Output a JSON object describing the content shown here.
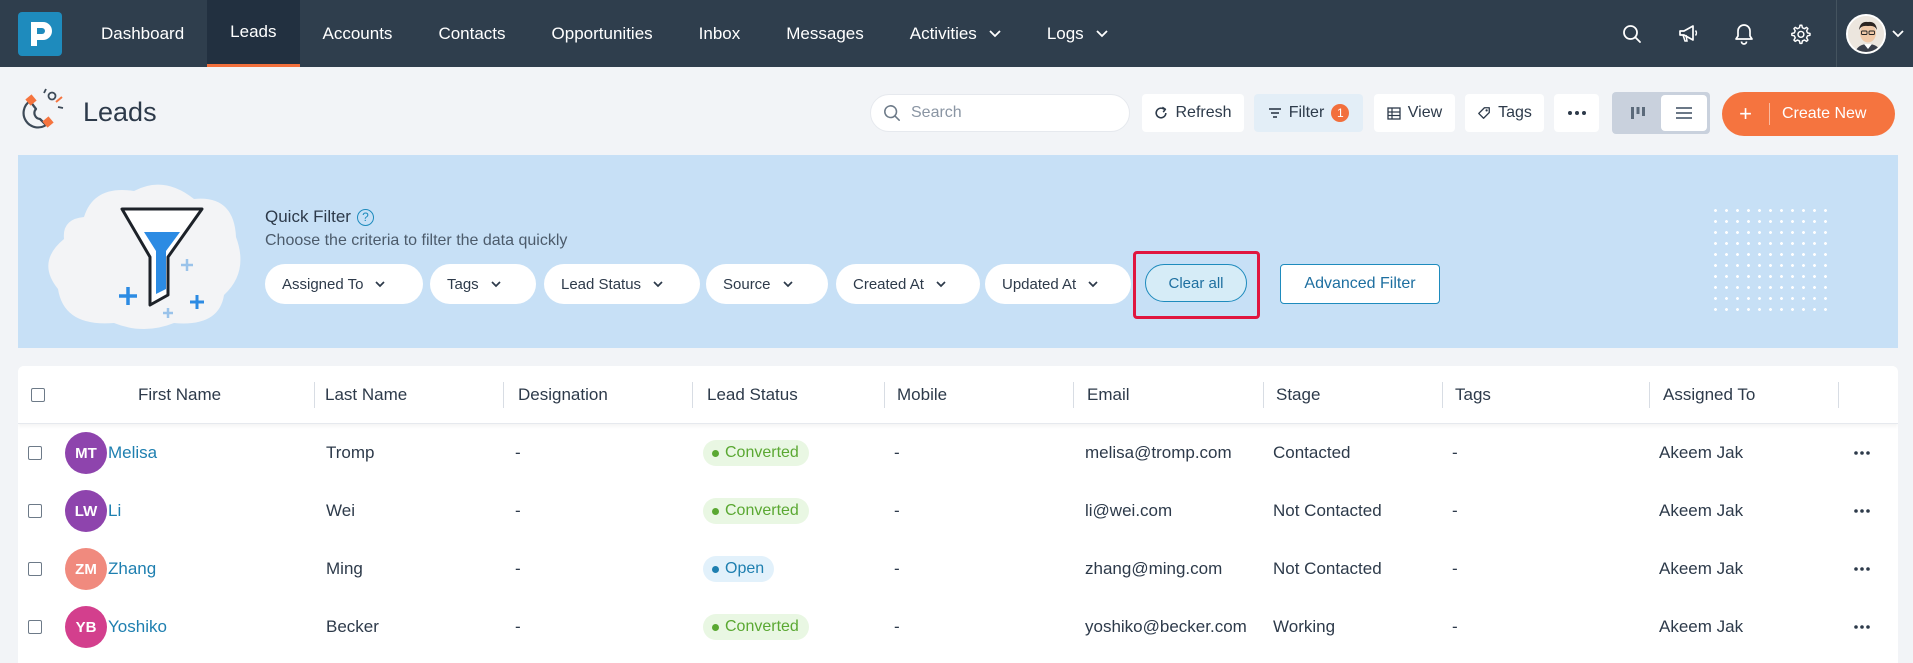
{
  "nav": {
    "items": [
      {
        "label": "Dashboard",
        "active": false,
        "dropdown": false
      },
      {
        "label": "Leads",
        "active": true,
        "dropdown": false
      },
      {
        "label": "Accounts",
        "active": false,
        "dropdown": false
      },
      {
        "label": "Contacts",
        "active": false,
        "dropdown": false
      },
      {
        "label": "Opportunities",
        "active": false,
        "dropdown": false
      },
      {
        "label": "Inbox",
        "active": false,
        "dropdown": false
      },
      {
        "label": "Messages",
        "active": false,
        "dropdown": false
      },
      {
        "label": "Activities",
        "active": false,
        "dropdown": true
      },
      {
        "label": "Logs",
        "active": false,
        "dropdown": true
      }
    ],
    "icons": [
      "search-icon",
      "megaphone-icon",
      "bell-icon",
      "gear-icon"
    ]
  },
  "header": {
    "title": "Leads",
    "search_placeholder": "Search",
    "refresh_label": "Refresh",
    "filter_label": "Filter",
    "filter_count": "1",
    "view_label": "View",
    "tags_label": "Tags",
    "create_label": "Create New",
    "create_plus": "+"
  },
  "quick_filter": {
    "title": "Quick Filter",
    "help": "?",
    "subtitle": "Choose the criteria to filter the data quickly",
    "chips": [
      "Assigned To",
      "Tags",
      "Lead Status",
      "Source",
      "Created At",
      "Updated At"
    ],
    "clear_label": "Clear all",
    "advanced_label": "Advanced Filter"
  },
  "table": {
    "columns": [
      "First Name",
      "Last Name",
      "Designation",
      "Lead Status",
      "Mobile",
      "Email",
      "Stage",
      "Tags",
      "Assigned To"
    ],
    "rows": [
      {
        "initials": "MT",
        "avatar_color": "#8e44ad",
        "first": "Melisa",
        "last": "Tromp",
        "designation": "-",
        "status": "Converted",
        "mobile": "-",
        "email": "melisa@tromp.com",
        "stage": "Contacted",
        "tags": "-",
        "assigned": "Akeem Jak"
      },
      {
        "initials": "LW",
        "avatar_color": "#8e44ad",
        "first": "Li",
        "last": "Wei",
        "designation": "-",
        "status": "Converted",
        "mobile": "-",
        "email": "li@wei.com",
        "stage": "Not Contacted",
        "tags": "-",
        "assigned": "Akeem Jak"
      },
      {
        "initials": "ZM",
        "avatar_color": "#f08a7e",
        "first": "Zhang",
        "last": "Ming",
        "designation": "-",
        "status": "Open",
        "mobile": "-",
        "email": "zhang@ming.com",
        "stage": "Not Contacted",
        "tags": "-",
        "assigned": "Akeem Jak"
      },
      {
        "initials": "YB",
        "avatar_color": "#d33f8d",
        "first": "Yoshiko",
        "last": "Becker",
        "designation": "-",
        "status": "Converted",
        "mobile": "-",
        "email": "yoshiko@becker.com",
        "stage": "Working",
        "tags": "-",
        "assigned": "Akeem Jak"
      }
    ]
  },
  "colors": {
    "nav_bg": "#2f3e4d",
    "accent": "#f5743f",
    "link": "#1e7fb0",
    "converted_bg": "#e9f7e3",
    "converted_text": "#5aa832",
    "open_bg": "#e2f1fb",
    "open_text": "#1e7fb0",
    "highlight": "#e0163f"
  }
}
